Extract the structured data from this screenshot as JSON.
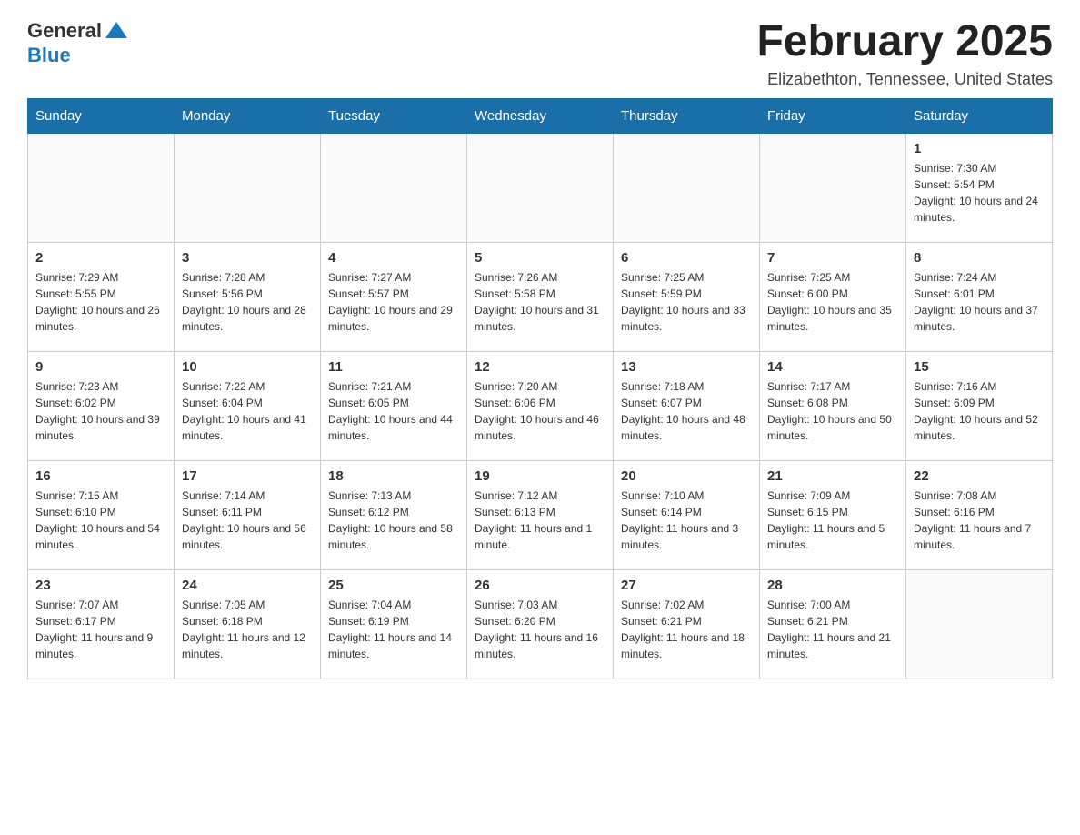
{
  "header": {
    "logo": {
      "general": "General",
      "blue": "Blue"
    },
    "title": "February 2025",
    "location": "Elizabethton, Tennessee, United States"
  },
  "calendar": {
    "days_of_week": [
      "Sunday",
      "Monday",
      "Tuesday",
      "Wednesday",
      "Thursday",
      "Friday",
      "Saturday"
    ],
    "weeks": [
      [
        {
          "day": "",
          "info": ""
        },
        {
          "day": "",
          "info": ""
        },
        {
          "day": "",
          "info": ""
        },
        {
          "day": "",
          "info": ""
        },
        {
          "day": "",
          "info": ""
        },
        {
          "day": "",
          "info": ""
        },
        {
          "day": "1",
          "info": "Sunrise: 7:30 AM\nSunset: 5:54 PM\nDaylight: 10 hours and 24 minutes."
        }
      ],
      [
        {
          "day": "2",
          "info": "Sunrise: 7:29 AM\nSunset: 5:55 PM\nDaylight: 10 hours and 26 minutes."
        },
        {
          "day": "3",
          "info": "Sunrise: 7:28 AM\nSunset: 5:56 PM\nDaylight: 10 hours and 28 minutes."
        },
        {
          "day": "4",
          "info": "Sunrise: 7:27 AM\nSunset: 5:57 PM\nDaylight: 10 hours and 29 minutes."
        },
        {
          "day": "5",
          "info": "Sunrise: 7:26 AM\nSunset: 5:58 PM\nDaylight: 10 hours and 31 minutes."
        },
        {
          "day": "6",
          "info": "Sunrise: 7:25 AM\nSunset: 5:59 PM\nDaylight: 10 hours and 33 minutes."
        },
        {
          "day": "7",
          "info": "Sunrise: 7:25 AM\nSunset: 6:00 PM\nDaylight: 10 hours and 35 minutes."
        },
        {
          "day": "8",
          "info": "Sunrise: 7:24 AM\nSunset: 6:01 PM\nDaylight: 10 hours and 37 minutes."
        }
      ],
      [
        {
          "day": "9",
          "info": "Sunrise: 7:23 AM\nSunset: 6:02 PM\nDaylight: 10 hours and 39 minutes."
        },
        {
          "day": "10",
          "info": "Sunrise: 7:22 AM\nSunset: 6:04 PM\nDaylight: 10 hours and 41 minutes."
        },
        {
          "day": "11",
          "info": "Sunrise: 7:21 AM\nSunset: 6:05 PM\nDaylight: 10 hours and 44 minutes."
        },
        {
          "day": "12",
          "info": "Sunrise: 7:20 AM\nSunset: 6:06 PM\nDaylight: 10 hours and 46 minutes."
        },
        {
          "day": "13",
          "info": "Sunrise: 7:18 AM\nSunset: 6:07 PM\nDaylight: 10 hours and 48 minutes."
        },
        {
          "day": "14",
          "info": "Sunrise: 7:17 AM\nSunset: 6:08 PM\nDaylight: 10 hours and 50 minutes."
        },
        {
          "day": "15",
          "info": "Sunrise: 7:16 AM\nSunset: 6:09 PM\nDaylight: 10 hours and 52 minutes."
        }
      ],
      [
        {
          "day": "16",
          "info": "Sunrise: 7:15 AM\nSunset: 6:10 PM\nDaylight: 10 hours and 54 minutes."
        },
        {
          "day": "17",
          "info": "Sunrise: 7:14 AM\nSunset: 6:11 PM\nDaylight: 10 hours and 56 minutes."
        },
        {
          "day": "18",
          "info": "Sunrise: 7:13 AM\nSunset: 6:12 PM\nDaylight: 10 hours and 58 minutes."
        },
        {
          "day": "19",
          "info": "Sunrise: 7:12 AM\nSunset: 6:13 PM\nDaylight: 11 hours and 1 minute."
        },
        {
          "day": "20",
          "info": "Sunrise: 7:10 AM\nSunset: 6:14 PM\nDaylight: 11 hours and 3 minutes."
        },
        {
          "day": "21",
          "info": "Sunrise: 7:09 AM\nSunset: 6:15 PM\nDaylight: 11 hours and 5 minutes."
        },
        {
          "day": "22",
          "info": "Sunrise: 7:08 AM\nSunset: 6:16 PM\nDaylight: 11 hours and 7 minutes."
        }
      ],
      [
        {
          "day": "23",
          "info": "Sunrise: 7:07 AM\nSunset: 6:17 PM\nDaylight: 11 hours and 9 minutes."
        },
        {
          "day": "24",
          "info": "Sunrise: 7:05 AM\nSunset: 6:18 PM\nDaylight: 11 hours and 12 minutes."
        },
        {
          "day": "25",
          "info": "Sunrise: 7:04 AM\nSunset: 6:19 PM\nDaylight: 11 hours and 14 minutes."
        },
        {
          "day": "26",
          "info": "Sunrise: 7:03 AM\nSunset: 6:20 PM\nDaylight: 11 hours and 16 minutes."
        },
        {
          "day": "27",
          "info": "Sunrise: 7:02 AM\nSunset: 6:21 PM\nDaylight: 11 hours and 18 minutes."
        },
        {
          "day": "28",
          "info": "Sunrise: 7:00 AM\nSunset: 6:21 PM\nDaylight: 11 hours and 21 minutes."
        },
        {
          "day": "",
          "info": ""
        }
      ]
    ]
  }
}
